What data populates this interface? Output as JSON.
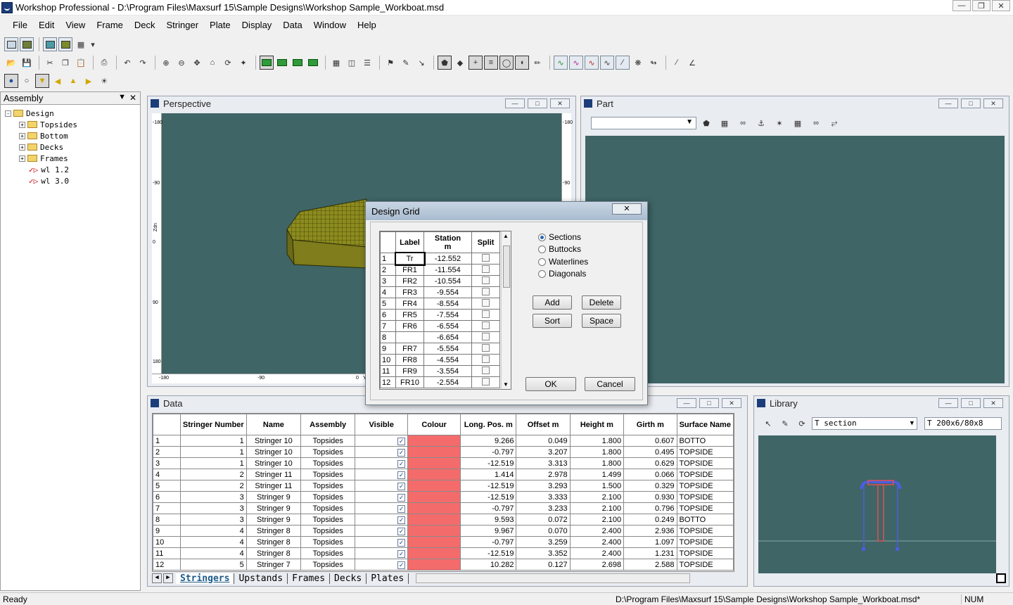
{
  "window": {
    "title": "Workshop Professional - D:\\Program Files\\Maxsurf 15\\Sample Designs\\Workshop Sample_Workboat.msd"
  },
  "menu": [
    "File",
    "Edit",
    "View",
    "Frame",
    "Deck",
    "Stringer",
    "Plate",
    "Display",
    "Data",
    "Window",
    "Help"
  ],
  "assembly": {
    "title": "Assembly",
    "tree": [
      {
        "label": "Design",
        "level": 0,
        "kind": "folder",
        "expand": "-"
      },
      {
        "label": "Topsides",
        "level": 1,
        "kind": "folder",
        "expand": "+"
      },
      {
        "label": "Bottom",
        "level": 1,
        "kind": "folder",
        "expand": "+"
      },
      {
        "label": "Decks",
        "level": 1,
        "kind": "folder",
        "expand": "+"
      },
      {
        "label": "Frames",
        "level": 1,
        "kind": "folder",
        "expand": "+"
      },
      {
        "label": "wl 1.2",
        "level": 1,
        "kind": "item",
        "expand": ""
      },
      {
        "label": "wl 3.0",
        "level": 1,
        "kind": "item",
        "expand": ""
      }
    ]
  },
  "perspective": {
    "title": "Perspective",
    "ruler_left": [
      "-180",
      "-90",
      "0",
      "90",
      "180"
    ],
    "ruler_right": [
      "-180",
      "-90"
    ],
    "ruler_bottom": [
      "-180",
      "-90",
      "0"
    ],
    "axis_z_label": "Zdn",
    "axis_y_label": "Ya"
  },
  "part": {
    "title": "Part"
  },
  "data_window": {
    "title": "Data",
    "columns": [
      "",
      "Stringer Number",
      "Name",
      "Assembly",
      "Visible",
      "Colour",
      "Long. Pos. m",
      "Offset m",
      "Height m",
      "Girth m",
      "Surface Name"
    ],
    "rows": [
      [
        "1",
        "1",
        "Stringer 10",
        "Topsides",
        "9.266",
        "0.049",
        "1.800",
        "0.607",
        "BOTTO"
      ],
      [
        "2",
        "1",
        "Stringer 10",
        "Topsides",
        "-0.797",
        "3.207",
        "1.800",
        "0.495",
        "TOPSIDE"
      ],
      [
        "3",
        "1",
        "Stringer 10",
        "Topsides",
        "-12.519",
        "3.313",
        "1.800",
        "0.629",
        "TOPSIDE"
      ],
      [
        "4",
        "2",
        "Stringer 11",
        "Topsides",
        "1.414",
        "2.978",
        "1.499",
        "0.066",
        "TOPSIDE"
      ],
      [
        "5",
        "2",
        "Stringer 11",
        "Topsides",
        "-12.519",
        "3.293",
        "1.500",
        "0.329",
        "TOPSIDE"
      ],
      [
        "6",
        "3",
        "Stringer 9",
        "Topsides",
        "-12.519",
        "3.333",
        "2.100",
        "0.930",
        "TOPSIDE"
      ],
      [
        "7",
        "3",
        "Stringer 9",
        "Topsides",
        "-0.797",
        "3.233",
        "2.100",
        "0.796",
        "TOPSIDE"
      ],
      [
        "8",
        "3",
        "Stringer 9",
        "Topsides",
        "9.593",
        "0.072",
        "2.100",
        "0.249",
        "BOTTO"
      ],
      [
        "9",
        "4",
        "Stringer 8",
        "Topsides",
        "9.967",
        "0.070",
        "2.400",
        "2.936",
        "TOPSIDE"
      ],
      [
        "10",
        "4",
        "Stringer 8",
        "Topsides",
        "-0.797",
        "3.259",
        "2.400",
        "1.097",
        "TOPSIDE"
      ],
      [
        "11",
        "4",
        "Stringer 8",
        "Topsides",
        "-12.519",
        "3.352",
        "2.400",
        "1.231",
        "TOPSIDE"
      ],
      [
        "12",
        "5",
        "Stringer 7",
        "Topsides",
        "10.282",
        "0.127",
        "2.698",
        "2.588",
        "TOPSIDE"
      ]
    ],
    "tabs": [
      "Stringers",
      "Upstands",
      "Frames",
      "Decks",
      "Plates"
    ],
    "colour_swatch": "#f46b6b"
  },
  "library": {
    "title": "Library",
    "type_select": "T section",
    "size_select": "T 200x6/80x8"
  },
  "design_grid": {
    "title": "Design Grid",
    "close": "✕",
    "col_label": "Label",
    "col_station": "Station",
    "col_station_unit": "m",
    "col_split": "Split",
    "rows": [
      [
        "1",
        "Tr",
        "-12.552"
      ],
      [
        "2",
        "FR1",
        "-11.554"
      ],
      [
        "3",
        "FR2",
        "-10.554"
      ],
      [
        "4",
        "FR3",
        "-9.554"
      ],
      [
        "5",
        "FR4",
        "-8.554"
      ],
      [
        "6",
        "FR5",
        "-7.554"
      ],
      [
        "7",
        "FR6",
        "-6.554"
      ],
      [
        "8",
        "",
        "-6.654"
      ],
      [
        "9",
        "FR7",
        "-5.554"
      ],
      [
        "10",
        "FR8",
        "-4.554"
      ],
      [
        "11",
        "FR9",
        "-3.554"
      ],
      [
        "12",
        "FR10",
        "-2.554"
      ]
    ],
    "radio_sections": "Sections",
    "radio_buttocks": "Buttocks",
    "radio_waterlines": "Waterlines",
    "radio_diagonals": "Diagonals",
    "btn_add": "Add",
    "btn_delete": "Delete",
    "btn_sort": "Sort",
    "btn_space": "Space",
    "btn_ok": "OK",
    "btn_cancel": "Cancel"
  },
  "status": {
    "left": "Ready",
    "path": "D:\\Program Files\\Maxsurf 15\\Sample Designs\\Workshop Sample_Workboat.msd*",
    "num": "NUM"
  },
  "colors": {
    "viewport": "#3f6566",
    "hull": "#8a8a1c",
    "swatch": "#f46b6b"
  }
}
